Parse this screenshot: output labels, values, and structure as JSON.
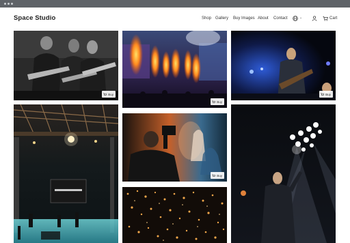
{
  "site": {
    "brand": "Space Studio"
  },
  "nav": {
    "items": [
      {
        "label": "Shop"
      },
      {
        "label": "Gallery"
      },
      {
        "label": "Buy Images"
      },
      {
        "label": "About"
      },
      {
        "label": "Contact"
      }
    ],
    "cart_label": "Cart",
    "language_icon": "globe-icon",
    "account_icon": "user-icon",
    "cart_icon": "cart-icon"
  },
  "gallery": {
    "buy_label": "Buy",
    "photos": [
      {
        "subject": "guitarists-black-and-white",
        "has_buy": true
      },
      {
        "subject": "stage-flames-crowd",
        "has_buy": true
      },
      {
        "subject": "guitarist-blue-stage",
        "has_buy": true
      },
      {
        "subject": "concert-hall-truss",
        "has_buy": false
      },
      {
        "subject": "camera-operator-stage",
        "has_buy": true
      },
      {
        "subject": "singer-spotlights",
        "has_buy": false
      },
      {
        "subject": "crowd-lights-bokeh",
        "has_buy": false
      }
    ]
  },
  "colors": {
    "accent": "#222222",
    "background": "#ffffff"
  }
}
